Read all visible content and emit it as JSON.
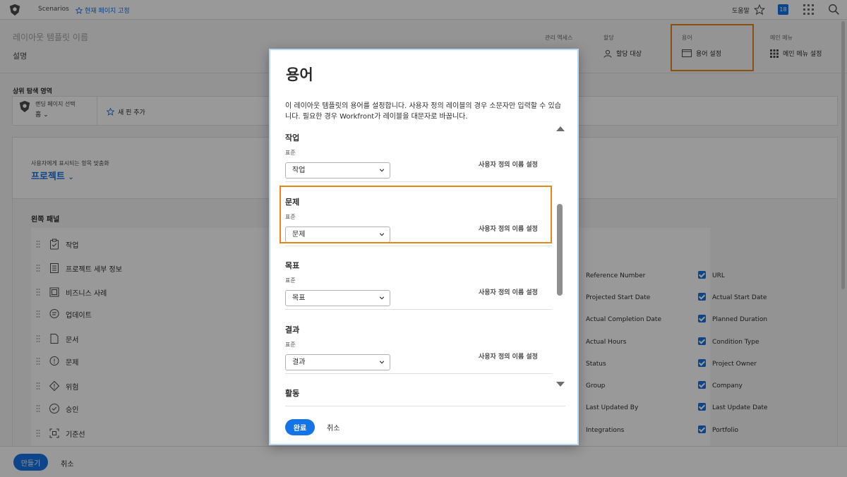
{
  "topbar": {
    "scenarios": "Scenarios",
    "pin_page": "현재 페이지 고정",
    "help": "도움말",
    "notification_count": "18"
  },
  "header": {
    "title_placeholder": "레이아웃 템플릿 이름",
    "description_placeholder": "설명",
    "groups": [
      {
        "label": "관리 액세스",
        "item": ""
      },
      {
        "label": "할당",
        "item": "할당 대상"
      },
      {
        "label": "용어",
        "item": "용어 설정"
      },
      {
        "label": "메인 메뉴",
        "item": "메인 메뉴 설정"
      }
    ]
  },
  "nav": {
    "section_title": "상위 탐색 영역",
    "landing_label": "랜딩 페이지 선택",
    "landing_value": "홈",
    "add_new": "새 핀 추가"
  },
  "customize": {
    "label": "사용자에게 표시되는 항목 맞춤화",
    "object": "프로젝트"
  },
  "left_panel": {
    "title": "왼쪽 패널",
    "items": [
      "작업",
      "프로젝트 세부 정보",
      "비즈니스 사례",
      "업데이트",
      "문서",
      "문제",
      "위험",
      "승인",
      "기준선"
    ]
  },
  "fields": {
    "col1": [
      "Reference Number",
      "Projected Start Date",
      "Actual Completion Date",
      "Actual Hours",
      "Status",
      "Group",
      "Last Updated By",
      "Integrations"
    ],
    "col2": [
      "URL",
      "Actual Start Date",
      "Planned Duration",
      "Condition Type",
      "Project Owner",
      "Company",
      "Last Update Date",
      "Portfolio"
    ]
  },
  "footer": {
    "create": "만들기",
    "cancel": "취소"
  },
  "modal": {
    "title": "용어",
    "description": "이 레이아웃 템플릿의 용어를 설정합니다. 사용자 정의 레이블의 경우 소문자만 입력할 수 있습니다. 필요한 경우 Workfront가 레이블을 대문자로 바꿉니다.",
    "standard_label": "표준",
    "custom_label": "사용자 정의 이름 설정",
    "sections": [
      {
        "name": "작업",
        "value": "작업"
      },
      {
        "name": "문제",
        "value": "문제"
      },
      {
        "name": "목표",
        "value": "목표"
      },
      {
        "name": "결과",
        "value": "결과"
      },
      {
        "name": "활동",
        "value": ""
      }
    ],
    "done": "완료",
    "cancel": "취소"
  },
  "colors": {
    "accent": "#1473e6",
    "highlight": "#e68619"
  }
}
